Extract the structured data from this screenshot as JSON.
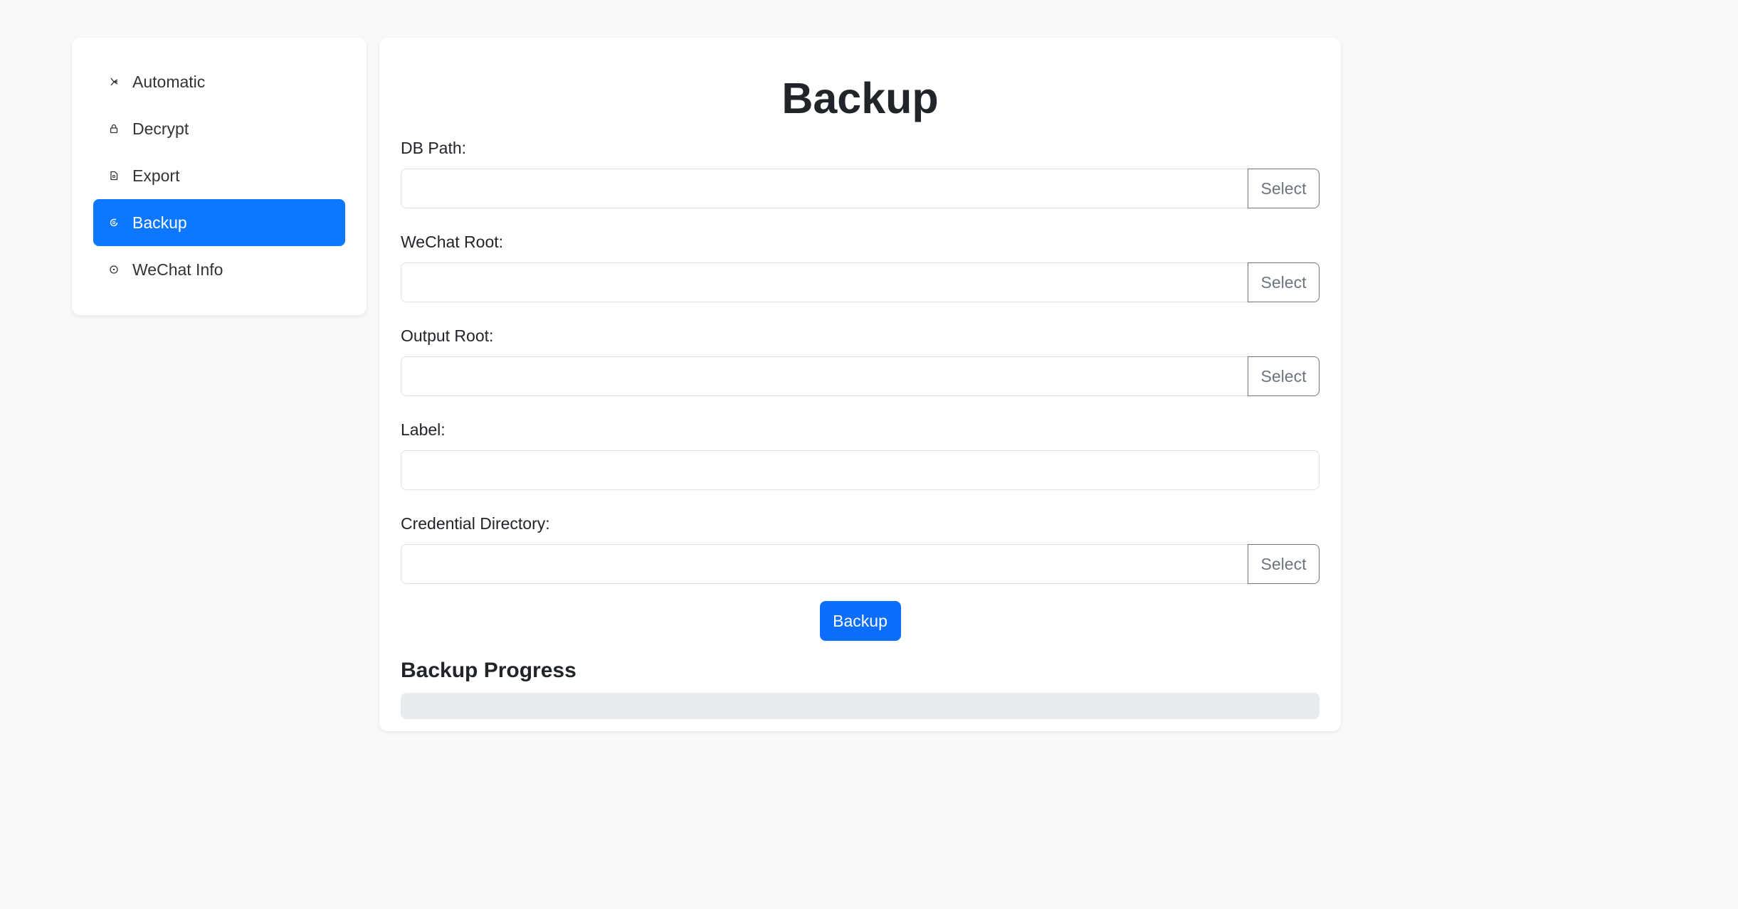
{
  "sidebar": {
    "items": [
      {
        "label": "Automatic",
        "icon": "sparkle-icon",
        "active": false
      },
      {
        "label": "Decrypt",
        "icon": "lock-icon",
        "active": false
      },
      {
        "label": "Export",
        "icon": "file-icon",
        "active": false
      },
      {
        "label": "Backup",
        "icon": "refresh-icon",
        "active": true
      },
      {
        "label": "WeChat Info",
        "icon": "info-circle-icon",
        "active": false
      }
    ]
  },
  "main": {
    "title": "Backup",
    "fields": {
      "db_path": {
        "label": "DB Path:",
        "value": "",
        "button": "Select"
      },
      "wechat_root": {
        "label": "WeChat Root:",
        "value": "",
        "button": "Select"
      },
      "output_root": {
        "label": "Output Root:",
        "value": "",
        "button": "Select"
      },
      "label": {
        "label": "Label:",
        "value": ""
      },
      "credential_directory": {
        "label": "Credential Directory:",
        "value": "",
        "button": "Select"
      }
    },
    "backup_button": "Backup",
    "progress": {
      "title": "Backup Progress",
      "percent": 0
    }
  },
  "colors": {
    "accent": "#0d6efd",
    "background": "#f8f9fa",
    "track": "#e9ecef"
  }
}
